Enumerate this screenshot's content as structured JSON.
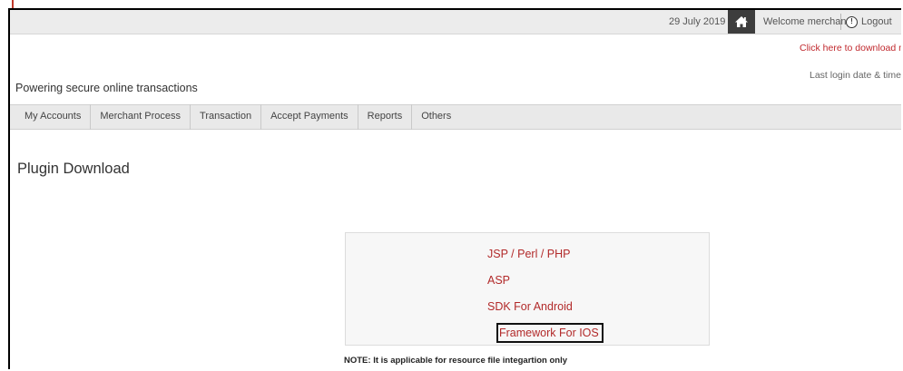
{
  "topbar": {
    "date": "29 July 2019",
    "welcome": "Welcome merchan...",
    "logout": "Logout"
  },
  "header": {
    "download_link": "Click here to download m",
    "last_login": "Last login date & time: :",
    "tagline": "Powering secure online transactions"
  },
  "nav": {
    "items": [
      {
        "label": "My Accounts"
      },
      {
        "label": "Merchant Process"
      },
      {
        "label": "Transaction"
      },
      {
        "label": "Accept Payments"
      },
      {
        "label": "Reports"
      },
      {
        "label": "Others"
      }
    ]
  },
  "main": {
    "title": "Plugin Download",
    "plugins": [
      {
        "label": "JSP / Perl / PHP"
      },
      {
        "label": "ASP"
      },
      {
        "label": "SDK For Android"
      },
      {
        "label": "Framework For IOS"
      }
    ],
    "note": "NOTE: It is applicable for resource file integartion only"
  },
  "colors": {
    "link_red": "#b22a2a",
    "home_bg": "#3d3d3d"
  },
  "icons": {
    "home": "home-icon",
    "user": "user-icon"
  }
}
